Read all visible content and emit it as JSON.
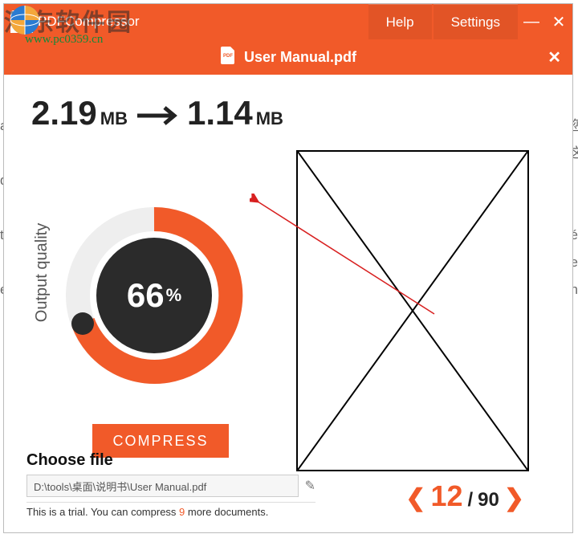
{
  "watermark": {
    "cn": "河东软件园",
    "url": "www.pc0359.cn"
  },
  "titlebar": {
    "app_name": "PDFCompressor",
    "help": "Help",
    "settings": "Settings"
  },
  "filebar": {
    "filename": "User Manual.pdf"
  },
  "sizes": {
    "orig_value": "2.19",
    "orig_unit": "MB",
    "new_value": "1.14",
    "new_unit": "MB"
  },
  "quality": {
    "label": "Output quality",
    "percent": "66",
    "pct_sign": "%"
  },
  "compress_label": "COMPRESS",
  "choose": {
    "title": "Choose file",
    "path": "D:\\tools\\桌面\\说明书\\User Manual.pdf"
  },
  "trial": {
    "prefix": "This is a trial. You can compress ",
    "remaining": "9",
    "suffix": " more documents."
  },
  "pager": {
    "current": "12",
    "sep": "/",
    "total": "90"
  }
}
